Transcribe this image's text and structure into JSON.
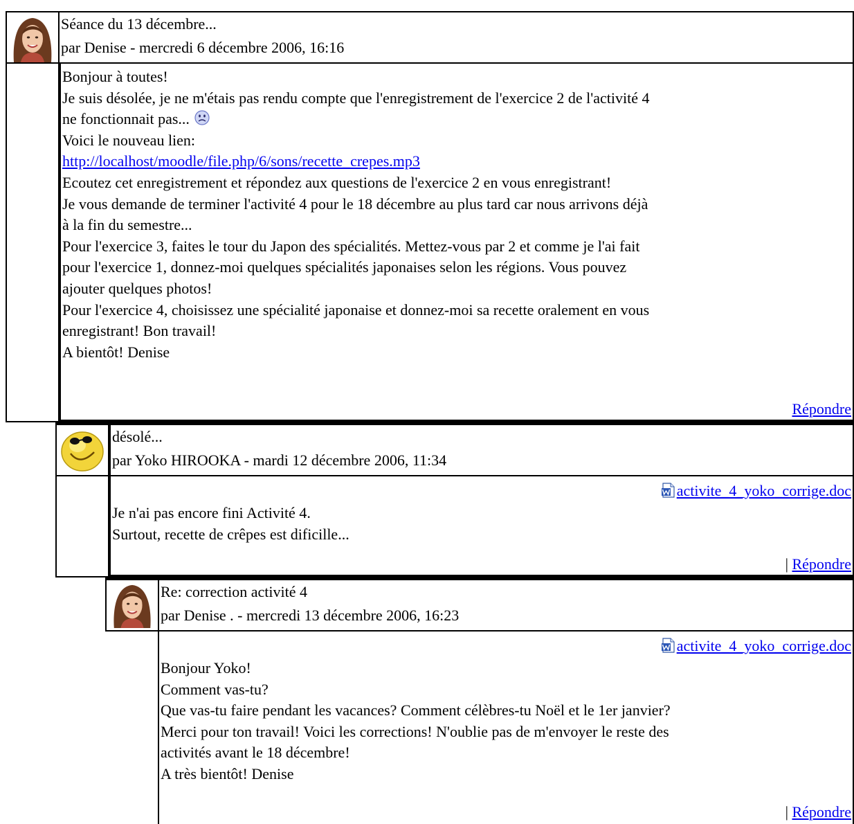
{
  "posts": [
    {
      "subject": "Séance du 13 décembre...",
      "byline": "par Denise - mercredi 6 décembre 2006, 16:16",
      "avatar": "female-user-photo",
      "message": {
        "l1": "Bonjour à toutes!",
        "l2": "Je suis désolée, je ne m'étais pas rendu compte que l'enregistrement de l'exercice 2 de l'activité 4",
        "l3": "ne fonctionnait pas...",
        "emoticon": "sad-face-icon",
        "l4": "Voici le nouveau lien:",
        "link": "http://localhost/moodle/file.php/6/sons/recette_crepes.mp3",
        "l5": "Ecoutez cet enregistrement et répondez aux questions de l'exercice 2 en vous enregistrant!",
        "l6": "Je vous demande de terminer l'activité 4 pour le 18 décembre au plus tard car nous arrivons déjà",
        "l7": "à la fin du semestre...",
        "l8": "Pour l'exercice 3, faites le tour du Japon des spécialités. Mettez-vous par 2 et comme je l'ai fait",
        "l9": "pour l'exercice 1, donnez-moi quelques spécialités japonaises selon les régions. Vous pouvez",
        "l10": "ajouter quelques photos!",
        "l11": "Pour l'exercice 4, choisissez une spécialité japonaise et donnez-moi sa recette oralement en vous",
        "l12": "enregistrant! Bon travail!",
        "l13": "A bientôt! Denise"
      },
      "reply": "Répondre"
    },
    {
      "subject": "désolé...",
      "byline": "par Yoko HIROOKA - mardi 12 décembre 2006, 11:34",
      "avatar": "smiley-sunglasses-avatar",
      "attachment": "activite_4_yoko_corrige.doc",
      "message": {
        "l1": "Je n'ai pas encore fini Activité 4.",
        "l2": "Surtout, recette de crêpes est dificille..."
      },
      "separator": "|",
      "reply": "Répondre"
    },
    {
      "subject": "Re: correction activité 4",
      "byline": "par Denise . - mercredi 13 décembre 2006, 16:23",
      "avatar": "female-user-photo",
      "attachment": "activite_4_yoko_corrige.doc",
      "message": {
        "l1": "Bonjour Yoko!",
        "l2": "Comment vas-tu?",
        "l3": "Que vas-tu faire pendant les vacances? Comment célèbres-tu Noël et le 1er janvier?",
        "l4": "Merci pour ton travail! Voici les corrections! N'oublie pas de m'envoyer le reste des",
        "l5": "activités avant le 18 décembre!",
        "l6": "A très bientôt! Denise"
      },
      "separator": "|",
      "reply": "Répondre"
    }
  ]
}
